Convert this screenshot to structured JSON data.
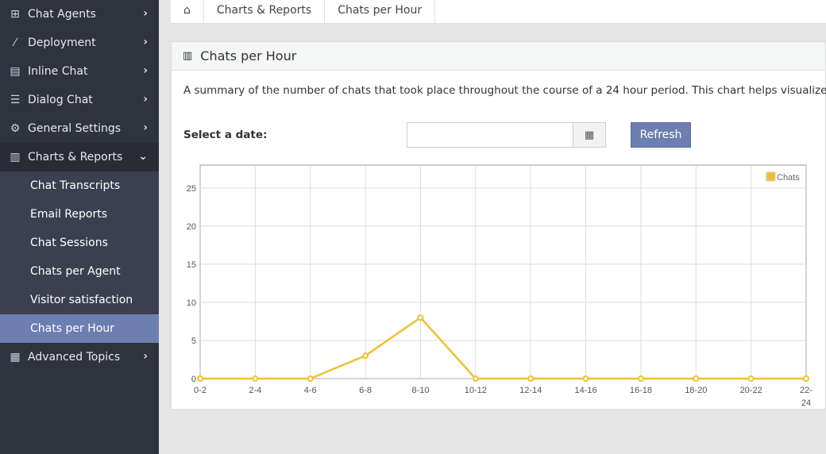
{
  "sidebar": {
    "items": [
      {
        "label": "Chat Agents",
        "icon": "sitemap-icon"
      },
      {
        "label": "Deployment",
        "icon": "magic-wand-icon"
      },
      {
        "label": "Inline Chat",
        "icon": "file-icon"
      },
      {
        "label": "Dialog Chat",
        "icon": "list-window-icon"
      },
      {
        "label": "General Settings",
        "icon": "gears-icon"
      },
      {
        "label": "Charts & Reports",
        "icon": "bar-chart-icon"
      },
      {
        "label": "Advanced Topics",
        "icon": "table-icon"
      }
    ],
    "sub": [
      "Chat Transcripts",
      "Email Reports",
      "Chat Sessions",
      "Chats per Agent",
      "Visitor satisfaction",
      "Chats per Hour"
    ]
  },
  "breadcrumb": [
    "Charts & Reports",
    "Chats per Hour"
  ],
  "panel": {
    "title": "Chats per Hour",
    "description": "A summary of the number of chats that took place throughout the course of a 24 hour period. This chart helps visualize what",
    "date_label": "Select a date:",
    "date_value": "",
    "refresh": "Refresh"
  },
  "chart_data": {
    "type": "line",
    "categories": [
      "0-2",
      "2-4",
      "4-6",
      "6-8",
      "8-10",
      "10-12",
      "12-14",
      "14-16",
      "16-18",
      "18-20",
      "20-22",
      "22-24"
    ],
    "series": [
      {
        "name": "Chats",
        "values": [
          0,
          0,
          0,
          3,
          8,
          0,
          0,
          0,
          0,
          0,
          0,
          0
        ],
        "color": "#f0c030"
      }
    ],
    "yticks": [
      0,
      5,
      10,
      15,
      20,
      25
    ],
    "ylim": [
      0,
      28
    ],
    "grid": true,
    "legend": "top-right"
  }
}
